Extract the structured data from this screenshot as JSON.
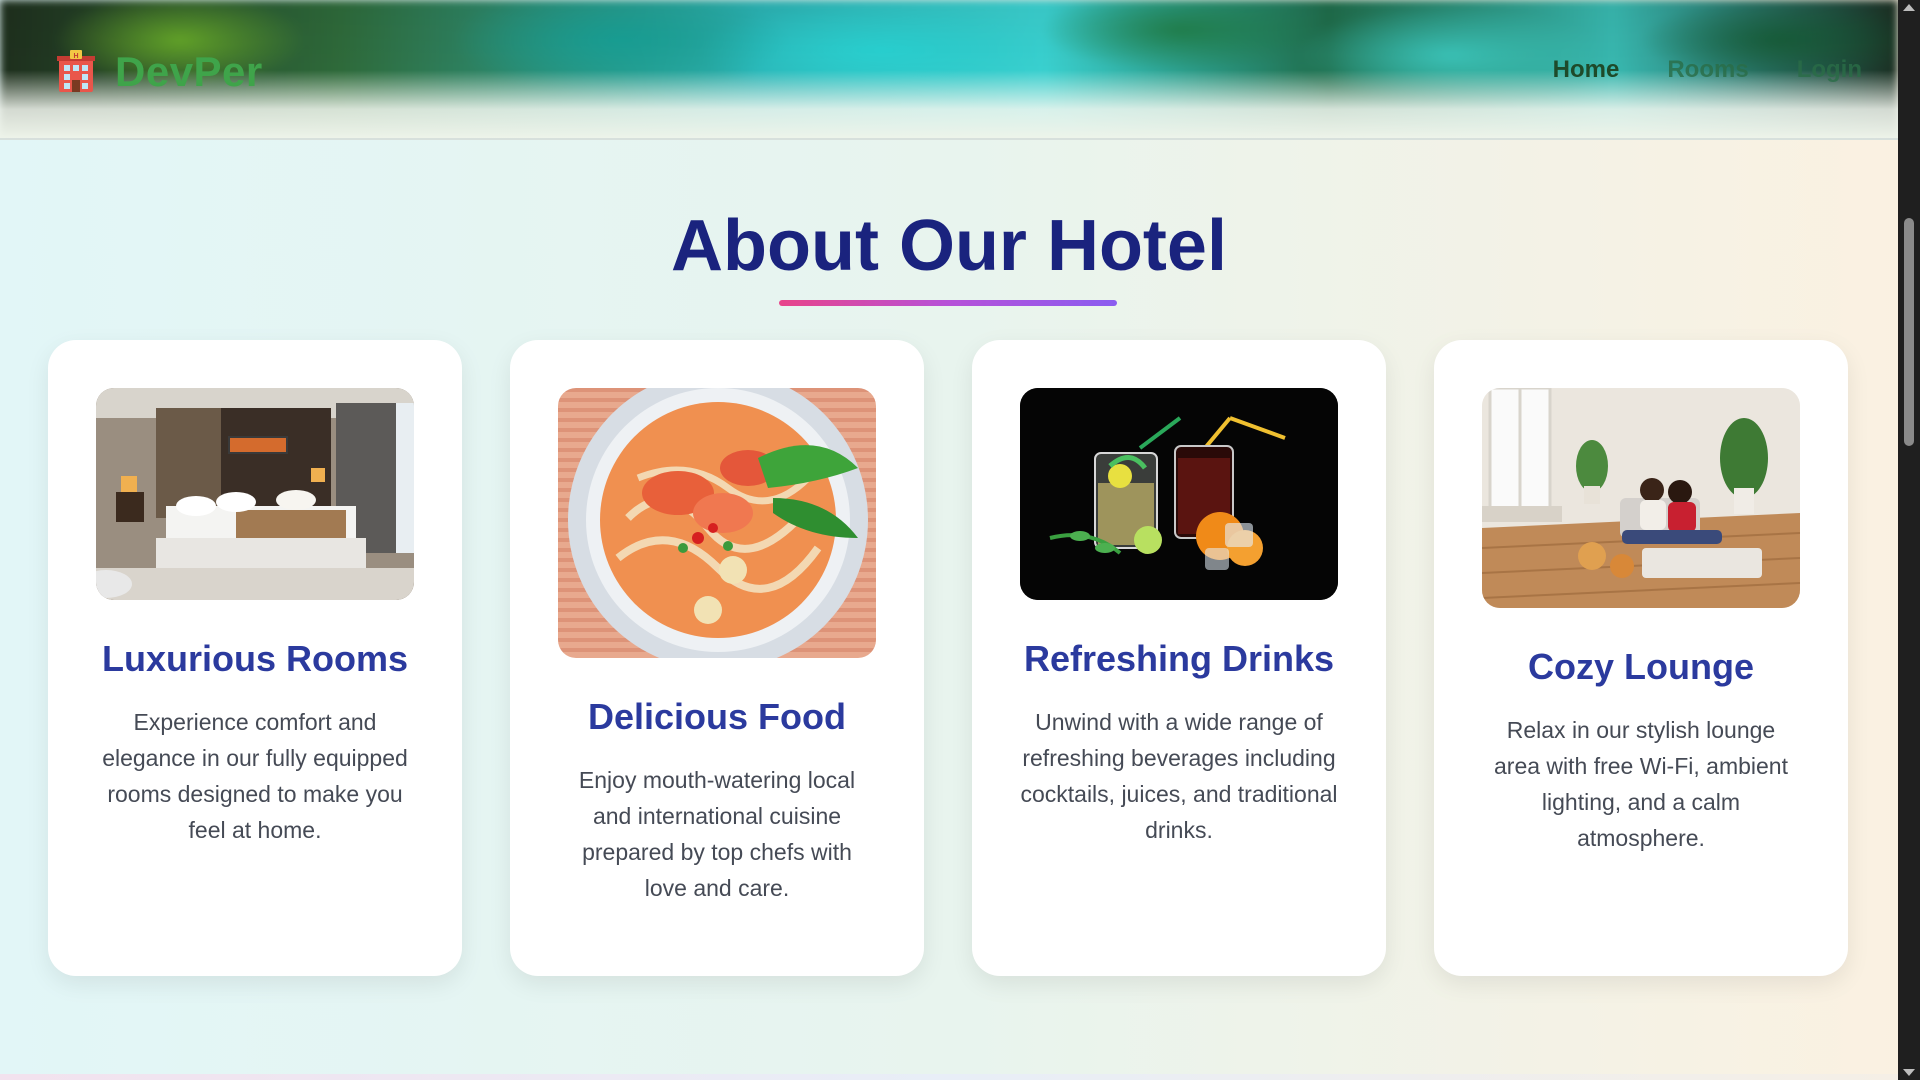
{
  "header": {
    "brand_name": "DevPer",
    "brand_icon": "hotel-icon",
    "nav": [
      {
        "label": "Home"
      },
      {
        "label": "Rooms"
      },
      {
        "label": "Login"
      }
    ]
  },
  "about": {
    "title": "About Our Hotel",
    "cards": [
      {
        "image_icon": "hotel-bedroom-image",
        "title": "Luxurious Rooms",
        "description": "Experience comfort and elegance in our fully equipped rooms designed to make you feel at home."
      },
      {
        "image_icon": "noodle-soup-image",
        "title": "Delicious Food",
        "description": "Enjoy mouth-watering local and international cuisine prepared by top chefs with love and care."
      },
      {
        "image_icon": "cocktail-drinks-image",
        "title": "Refreshing Drinks",
        "description": "Unwind with a wide range of refreshing beverages including cocktails, juices, and traditional drinks."
      },
      {
        "image_icon": "lounge-couple-image",
        "title": "Cozy Lounge",
        "description": "Relax in our stylish lounge area with free Wi-Fi, ambient lighting, and a calm atmosphere."
      }
    ]
  },
  "colors": {
    "brand": "#3fa44a",
    "title": "#1a237e",
    "card_title": "#2b3a9e",
    "underline_start": "#e8448a",
    "underline_end": "#8a5cf0"
  }
}
